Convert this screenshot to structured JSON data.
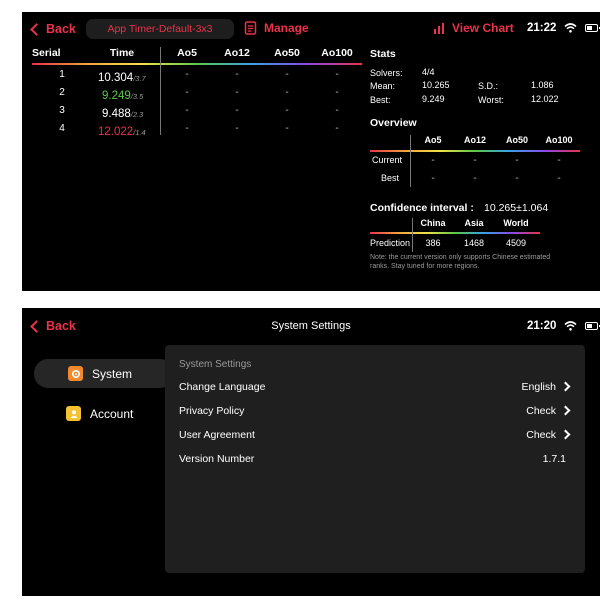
{
  "timer": {
    "back_label": "Back",
    "session_name": "App Timer-Default-3x3",
    "manage_label": "Manage",
    "view_chart_label": "View Chart",
    "time": "21:22",
    "table": {
      "headers": [
        "Serial",
        "Time",
        "Ao5",
        "Ao12",
        "Ao50",
        "Ao100"
      ],
      "rows": [
        {
          "serial": "1",
          "time": "10.304",
          "sub": "/3.7",
          "ao5": "-",
          "ao12": "-",
          "ao50": "-",
          "ao100": "-"
        },
        {
          "serial": "2",
          "time": "9.249",
          "sub": "/3.5",
          "ao5": "-",
          "ao12": "-",
          "ao50": "-",
          "ao100": "-"
        },
        {
          "serial": "3",
          "time": "9.488",
          "sub": "/2.3",
          "ao5": "-",
          "ao12": "-",
          "ao50": "-",
          "ao100": "-"
        },
        {
          "serial": "4",
          "time": "12.022",
          "sub": "/1.4",
          "ao5": "-",
          "ao12": "-",
          "ao50": "-",
          "ao100": "-"
        }
      ]
    },
    "stats": {
      "title": "Stats",
      "solvers_label": "Solvers:",
      "solvers_value": "4/4",
      "mean_label": "Mean:",
      "mean_value": "10.265",
      "sd_label": "S.D.:",
      "sd_value": "1.086",
      "best_label": "Best:",
      "best_value": "9.249",
      "worst_label": "Worst:",
      "worst_value": "12.022"
    },
    "overview": {
      "title": "Overview",
      "headers": [
        "Ao5",
        "Ao12",
        "Ao50",
        "Ao100"
      ],
      "current_label": "Current",
      "best_label": "Best",
      "current": [
        "-",
        "-",
        "-",
        "-"
      ],
      "best": [
        "-",
        "-",
        "-",
        "-"
      ]
    },
    "confidence": {
      "label": "Confidence interval :",
      "value": "10.265±1.064",
      "headers": [
        "China",
        "Asia",
        "World"
      ],
      "prediction_label": "Prediction",
      "values": [
        "386",
        "1468",
        "4509"
      ],
      "note_line1": "Note: the current version only supports Chinese estimated",
      "note_line2": "ranks. Stay tuned for more regions."
    },
    "colors": {
      "accent": "#e8334a",
      "best": "#5cc84a",
      "background": "#000000"
    }
  },
  "settings": {
    "back_label": "Back",
    "title": "System Settings",
    "time": "21:20",
    "sidebar": [
      {
        "label": "System",
        "icon": "gear-icon",
        "icon_color": "#f08a2c",
        "selected": true
      },
      {
        "label": "Account",
        "icon": "person-icon",
        "icon_color": "#f4c233",
        "selected": false
      }
    ],
    "panel": {
      "heading": "System Settings",
      "rows": [
        {
          "label": "Change Language",
          "value": "English",
          "chevron": true
        },
        {
          "label": "Privacy Policy",
          "value": "Check",
          "chevron": true
        },
        {
          "label": "User Agreement",
          "value": "Check",
          "chevron": true
        },
        {
          "label": "Version Number",
          "value": "1.7.1",
          "chevron": false
        }
      ]
    }
  }
}
